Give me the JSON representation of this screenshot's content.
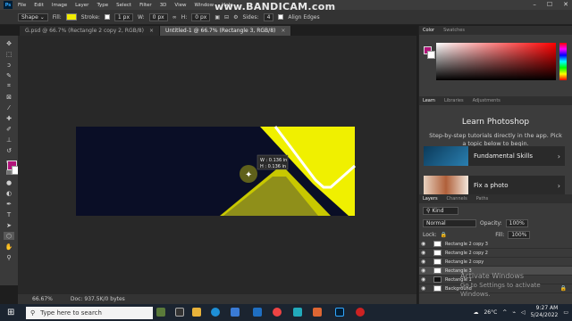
{
  "app": {
    "logo": "Ps"
  },
  "watermark": "www.BANDICAM.com",
  "menu": [
    "File",
    "Edit",
    "Image",
    "Layer",
    "Type",
    "Select",
    "Filter",
    "3D",
    "View",
    "Window",
    "Help"
  ],
  "options": {
    "mode": "Shape",
    "fill_label": "Fill:",
    "stroke_label": "Stroke:",
    "stroke_size": "1 px",
    "w_label": "W:",
    "w_value": "0 px",
    "h_label": "H:",
    "h_value": "0 px",
    "sides_label": "Sides:",
    "sides_value": "4",
    "align_label": "Align Edges"
  },
  "tabs": [
    {
      "label": "G.psd @ 66.7% (Rectangle 2 copy 2, RGB/8)",
      "active": false
    },
    {
      "label": "Untitled-1 @ 66.7% (Rectangle 3, RGB/8)",
      "active": true
    }
  ],
  "tools": [
    "move-icon",
    "marquee-icon",
    "lasso-icon",
    "quick-select-icon",
    "crop-icon",
    "frame-icon",
    "eyedropper-icon",
    "healing-icon",
    "brush-icon",
    "stamp-icon",
    "history-brush-icon",
    "eraser-icon",
    "gradient-icon",
    "blur-icon",
    "dodge-icon",
    "pen-icon",
    "type-icon",
    "path-select-icon",
    "shape-icon",
    "hand-icon",
    "zoom-icon"
  ],
  "colors": {
    "foreground": "#b2147a",
    "background": "#ffffff",
    "yellow": "#f0f000",
    "olive": "#8f8f1a",
    "navy": "#0a0e26"
  },
  "transform_readout": {
    "w": "W : 0.136 in",
    "h": "H : 0.136 in"
  },
  "status": {
    "zoom": "66.67%",
    "doc": "Doc: 937.5K/0 bytes"
  },
  "color_panel": {
    "tabs": [
      "Color",
      "Swatches"
    ]
  },
  "learn_panel": {
    "tabs": [
      "Learn",
      "Libraries",
      "Adjustments"
    ],
    "title": "Learn Photoshop",
    "description": "Step-by-step tutorials directly in the app. Pick a topic below to begin.",
    "cards": [
      {
        "label": "Fundamental Skills"
      },
      {
        "label": "Fix a photo"
      }
    ]
  },
  "layers_panel": {
    "tabs": [
      "Layers",
      "Channels",
      "Paths"
    ],
    "kind": "Kind",
    "blend": "Normal",
    "opacity_label": "Opacity:",
    "opacity": "100%",
    "lock_label": "Lock:",
    "fill_label": "Fill:",
    "fill": "100%",
    "layers": [
      {
        "name": "Rectangle 2 copy 3",
        "selected": false,
        "dark": false
      },
      {
        "name": "Rectangle 2 copy 2",
        "selected": false,
        "dark": false
      },
      {
        "name": "Rectangle 2 copy",
        "selected": false,
        "dark": false
      },
      {
        "name": "Rectangle 3",
        "selected": true,
        "dark": false
      },
      {
        "name": "Rectangle 1",
        "selected": false,
        "dark": true
      },
      {
        "name": "Background",
        "selected": false,
        "dark": false
      }
    ]
  },
  "activate": {
    "title": "Activate Windows",
    "subtitle": "Go to Settings to activate Windows."
  },
  "taskbar": {
    "search_placeholder": "Type here to search",
    "weather": "26°C",
    "time": "9:27 AM",
    "date": "5/24/2022"
  }
}
